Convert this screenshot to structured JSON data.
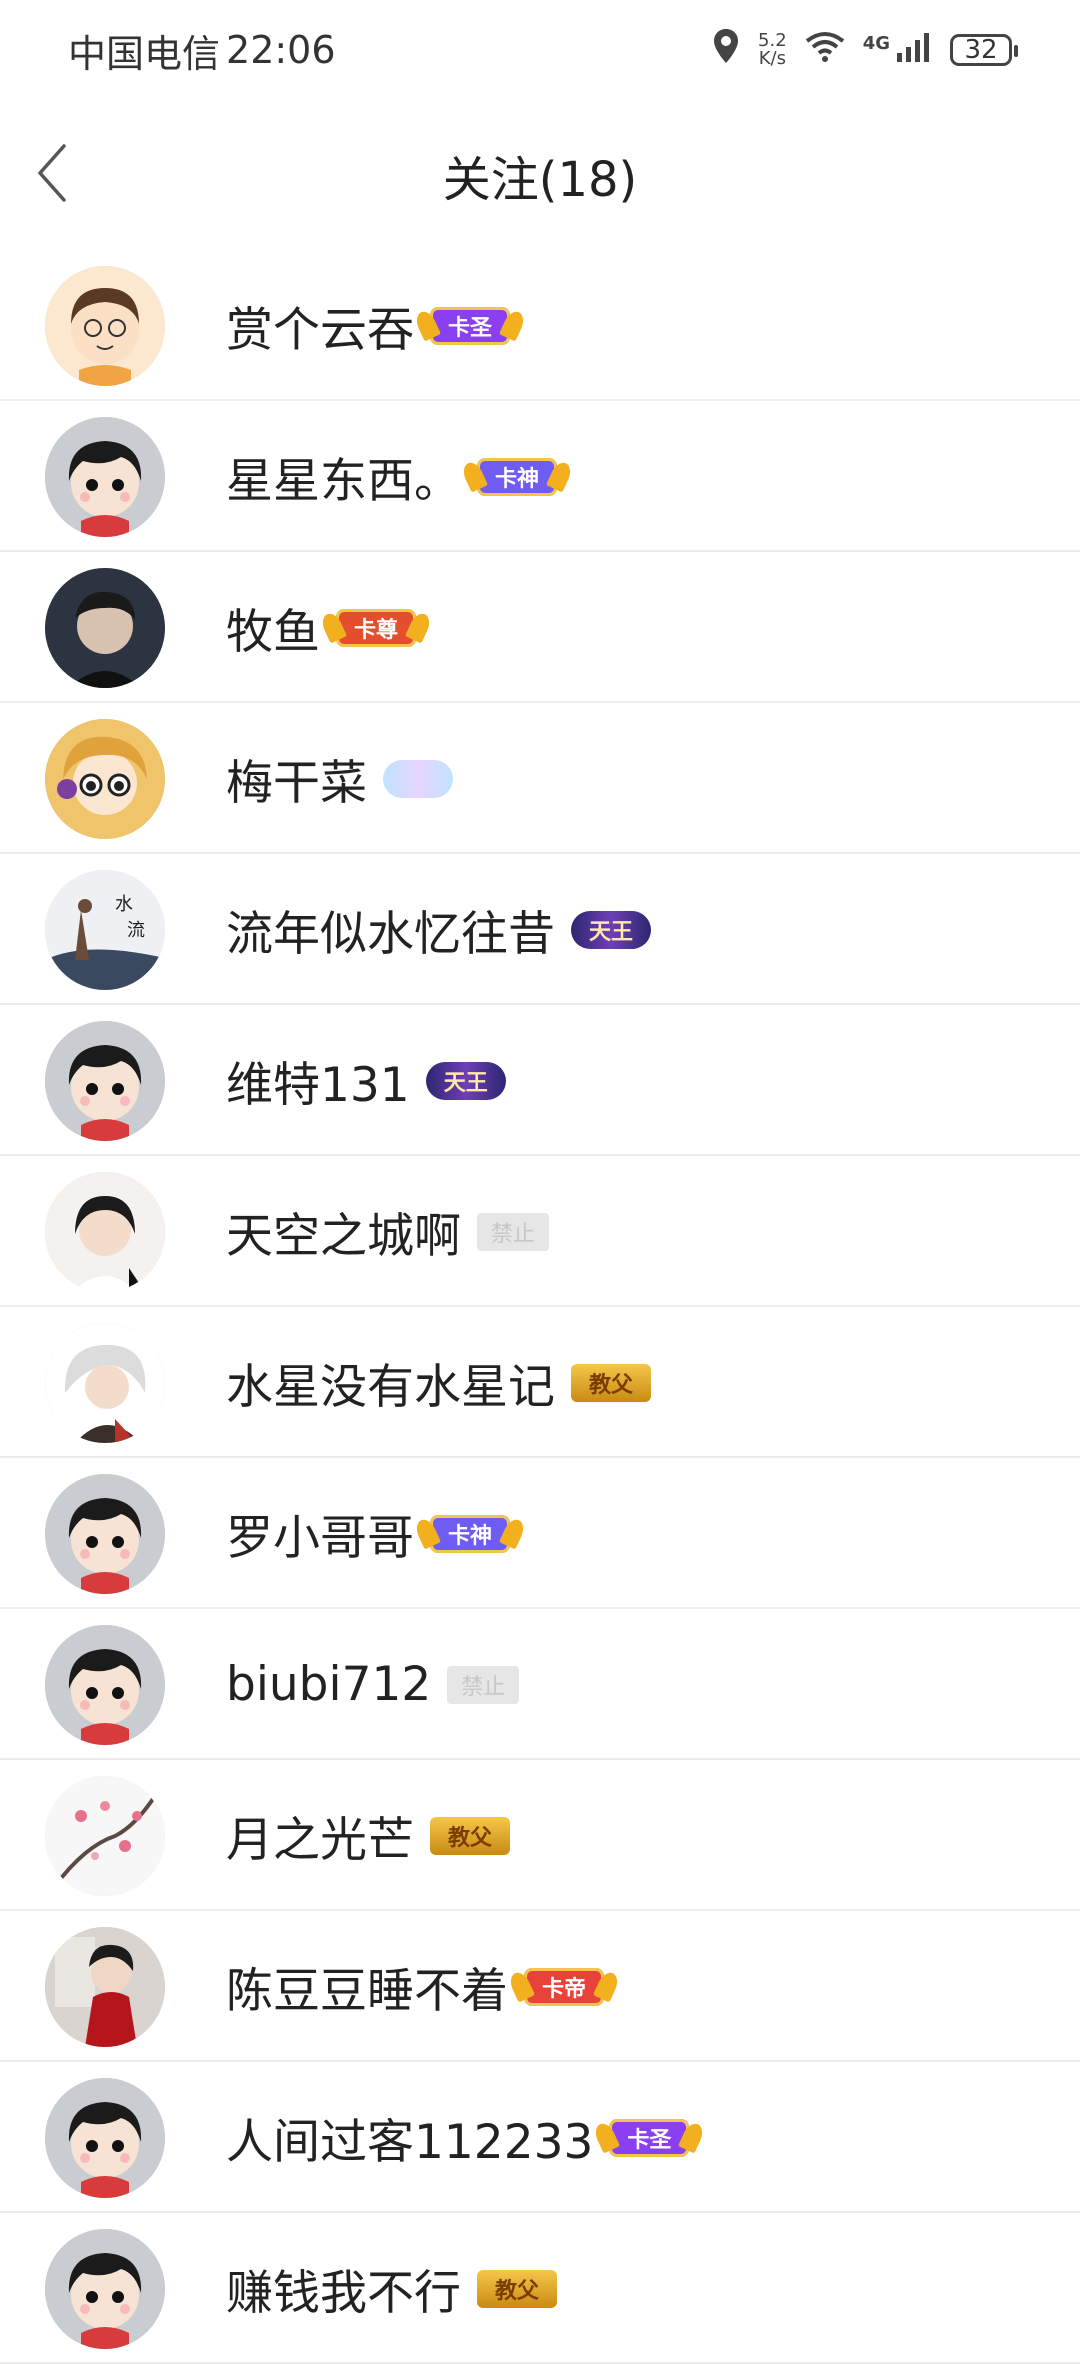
{
  "status_bar": {
    "carrier": "中国电信",
    "time": "22:06",
    "speed_value": "5.2",
    "speed_unit": "K/s",
    "network": "4G",
    "battery": "32"
  },
  "header": {
    "title": "关注(18)",
    "back_icon": "chevron-left-icon"
  },
  "follow_list": [
    {
      "name": "赏个云吞",
      "badge": "卡圣",
      "badge_style": "crown",
      "badge_color": "#8a3ff0",
      "avatar": "cartoon-boy"
    },
    {
      "name": "星星东西。",
      "badge": "卡神",
      "badge_style": "crown",
      "badge_color": "#6f5cf2",
      "avatar": "default"
    },
    {
      "name": "牧鱼",
      "badge": "卡尊",
      "badge_style": "crown",
      "badge_color": "#e44d2e",
      "avatar": "photo-dark"
    },
    {
      "name": "梅干菜",
      "badge": "",
      "badge_style": "cloud",
      "badge_color": "#bfe3ff",
      "avatar": "anime-blonde"
    },
    {
      "name": "流年似水忆往昔",
      "badge": "天王",
      "badge_style": "king",
      "badge_color": "#4b2e9e",
      "avatar": "ink-painting"
    },
    {
      "name": "维特131",
      "badge": "天王",
      "badge_style": "king",
      "badge_color": "#4b2e9e",
      "avatar": "default"
    },
    {
      "name": "天空之城啊",
      "badge": "禁止",
      "badge_style": "banned",
      "badge_color": "#e6e6e6",
      "avatar": "photo-woman"
    },
    {
      "name": "水星没有水星记",
      "badge": "教父",
      "badge_style": "godfather",
      "badge_color": "#e3a826",
      "avatar": "anime-white-hair"
    },
    {
      "name": "罗小哥哥",
      "badge": "卡神",
      "badge_style": "crown",
      "badge_color": "#6f5cf2",
      "avatar": "default"
    },
    {
      "name": "biubi712",
      "badge": "禁止",
      "badge_style": "banned",
      "badge_color": "#e6e6e6",
      "avatar": "default"
    },
    {
      "name": "月之光芒",
      "badge": "教父",
      "badge_style": "godfather",
      "badge_color": "#e3a826",
      "avatar": "plum-blossom"
    },
    {
      "name": "陈豆豆睡不着",
      "badge": "卡帝",
      "badge_style": "crown",
      "badge_color": "#e8433a",
      "avatar": "photo-red"
    },
    {
      "name": "人间过客112233",
      "badge": "卡圣",
      "badge_style": "crown",
      "badge_color": "#8a3ff0",
      "avatar": "default"
    },
    {
      "name": "赚钱我不行",
      "badge": "教父",
      "badge_style": "godfather",
      "badge_color": "#e3a826",
      "avatar": "default"
    }
  ]
}
